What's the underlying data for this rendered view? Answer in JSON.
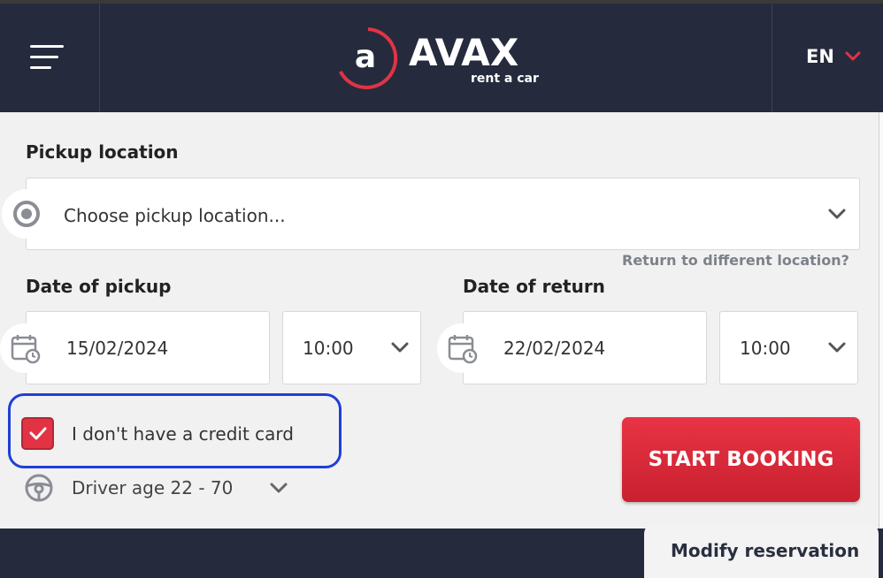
{
  "header": {
    "brand_name": "AVAX",
    "brand_letter": "a",
    "brand_tagline": "rent a car",
    "language": "EN"
  },
  "pickup": {
    "label": "Pickup location",
    "placeholder": "Choose pickup location...",
    "return_link": "Return to different location?"
  },
  "pickup_date": {
    "label": "Date of pickup",
    "date": "15/02/2024",
    "time": "10:00"
  },
  "return_date": {
    "label": "Date of return",
    "date": "22/02/2024",
    "time": "10:00"
  },
  "credit_card": {
    "label": "I don't have a credit card",
    "checked": true
  },
  "driver_age": {
    "label": "Driver age 22 - 70"
  },
  "actions": {
    "start_booking": "START BOOKING",
    "modify_reservation": "Modify reservation"
  },
  "colors": {
    "header_bg": "#252b3d",
    "accent_red": "#e23344",
    "highlight_blue": "#1f3fd8"
  }
}
